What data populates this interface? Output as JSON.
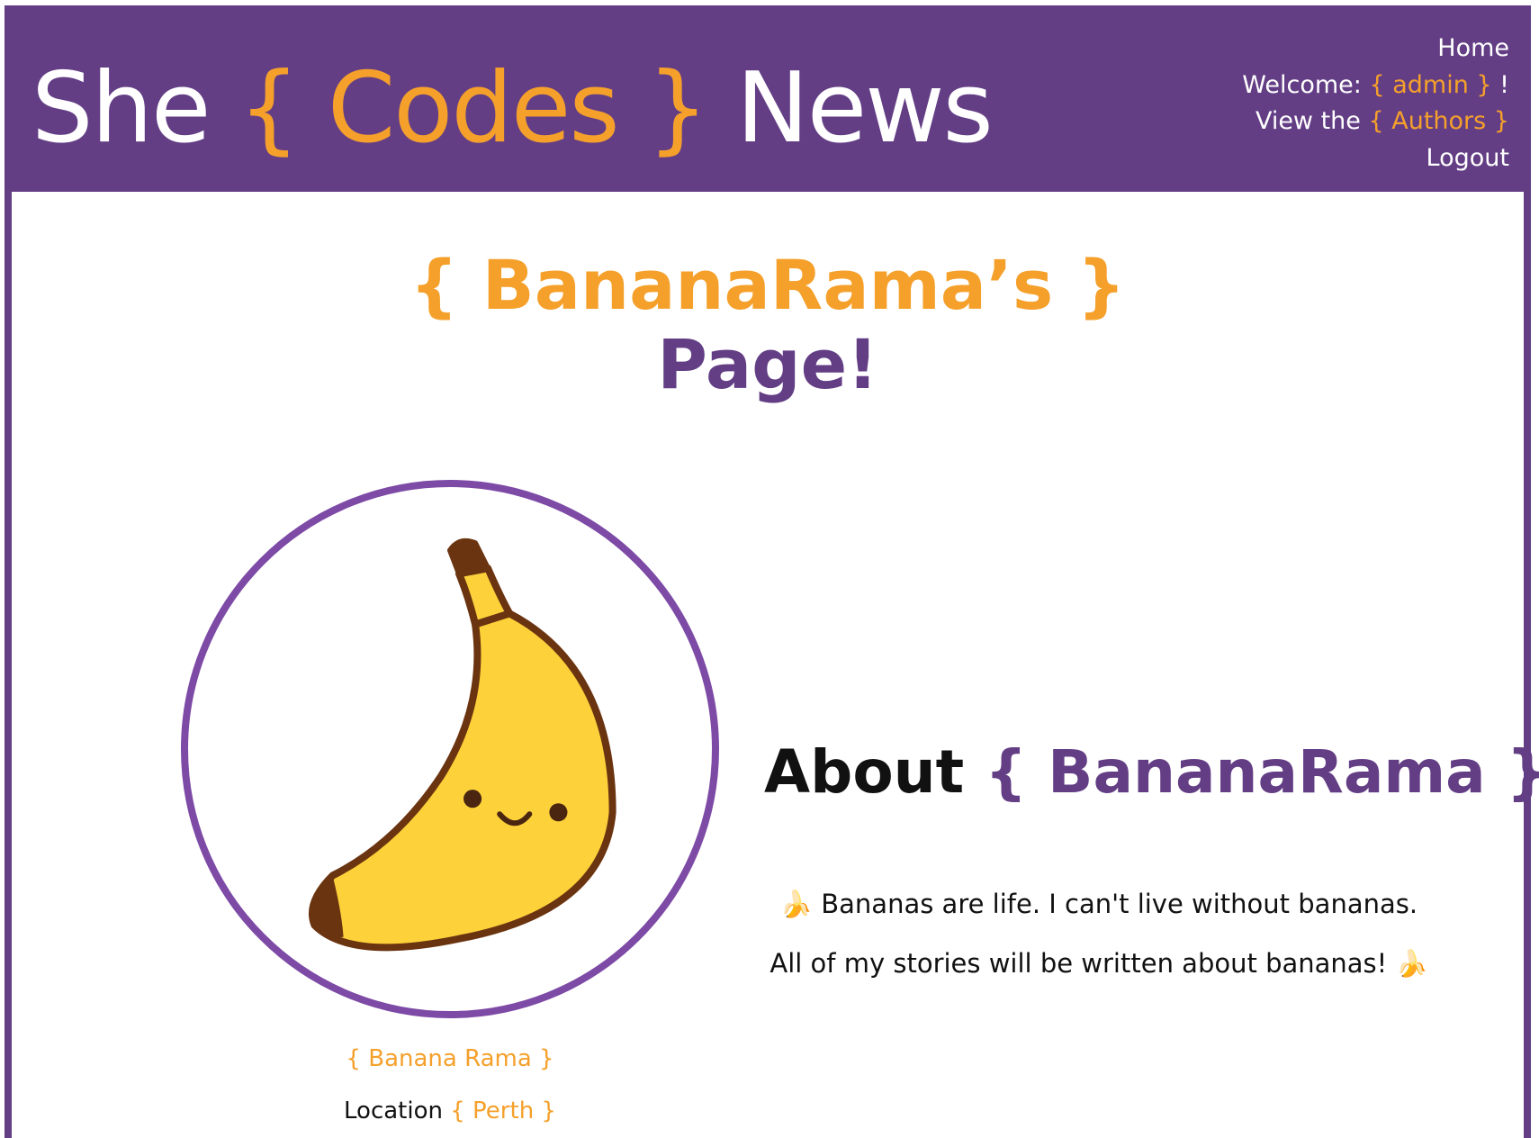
{
  "header": {
    "brand": {
      "prefix": "She",
      "middle": "{ Codes }",
      "suffix": "News"
    },
    "nav": {
      "home": "Home",
      "welcome_prefix": "Welcome: ",
      "welcome_user": "{ admin }",
      "welcome_suffix": " !",
      "authors_prefix": "View the ",
      "authors_link": "{ Authors }",
      "logout": "Logout"
    }
  },
  "profile": {
    "title_name": "{ BananaRama’s }",
    "title_page": "Page!",
    "avatar_icon": "banana-icon",
    "display_name": "{ Banana Rama }",
    "location_label": "Location ",
    "location_value": "{ Perth }",
    "about_label": "About ",
    "about_name": "{ BananaRama }",
    "bio": "🍌 Bananas are life. I can't live without bananas. All of my stories will be written about bananas! 🍌"
  },
  "colors": {
    "primary": "#633e85",
    "accent": "#f5a02b",
    "avatar_border": "#7d4aa6"
  }
}
